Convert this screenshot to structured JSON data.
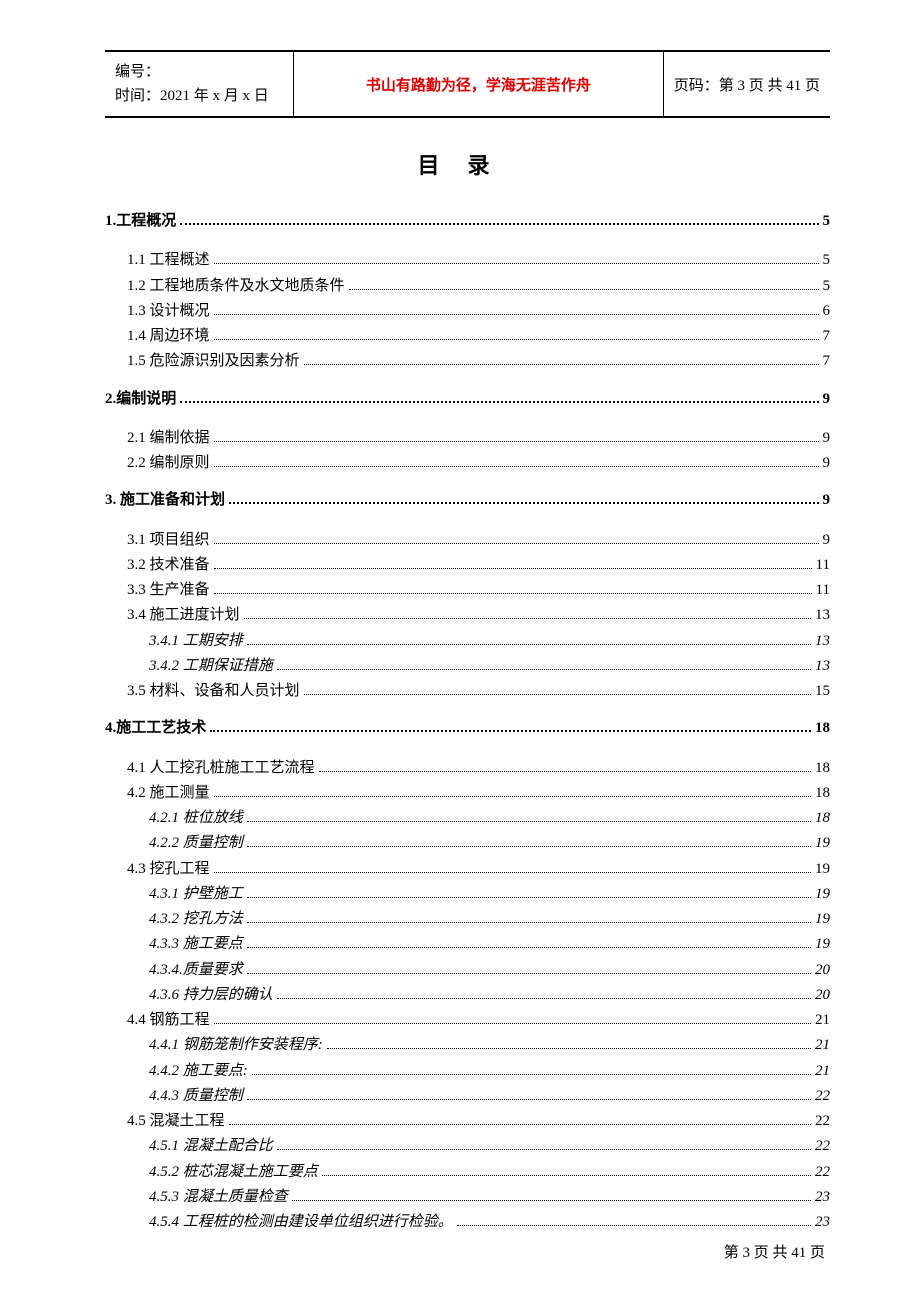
{
  "header": {
    "serial_label": "编号：",
    "time_label": "时间：2021 年 x 月 x 日",
    "center_text": "书山有路勤为径，学海无涯苦作舟",
    "page_code": "页码：第 3 页  共 41 页"
  },
  "toc_title": "目录",
  "toc": [
    {
      "label": "1.工程概况",
      "page": "5",
      "level": 1
    },
    {
      "label": "1.1 工程概述",
      "page": "5",
      "level": 2
    },
    {
      "label": "1.2 工程地质条件及水文地质条件",
      "page": "5",
      "level": 2
    },
    {
      "label": "1.3 设计概况",
      "page": "6",
      "level": 2
    },
    {
      "label": "1.4 周边环境",
      "page": "7",
      "level": 2
    },
    {
      "label": "1.5 危险源识别及因素分析",
      "page": "7",
      "level": 2
    },
    {
      "label": "2.编制说明",
      "page": "9",
      "level": 1
    },
    {
      "label": "2.1 编制依据",
      "page": "9",
      "level": 2
    },
    {
      "label": "2.2 编制原则",
      "page": "9",
      "level": 2
    },
    {
      "label": "3.  施工准备和计划",
      "page": "9",
      "level": 1
    },
    {
      "label": "3.1 项目组织",
      "page": "9",
      "level": 2
    },
    {
      "label": "3.2 技术准备",
      "page": "11",
      "level": 2
    },
    {
      "label": "3.3 生产准备",
      "page": "11",
      "level": 2
    },
    {
      "label": "3.4 施工进度计划",
      "page": "13",
      "level": 2
    },
    {
      "label": "3.4.1 工期安排",
      "page": "13",
      "level": 3
    },
    {
      "label": "3.4.2 工期保证措施",
      "page": "13",
      "level": 3
    },
    {
      "label": "3.5 材料、设备和人员计划",
      "page": "15",
      "level": 2
    },
    {
      "label": "4.施工工艺技术",
      "page": "18",
      "level": 1
    },
    {
      "label": "4.1 人工挖孔桩施工工艺流程",
      "page": "18",
      "level": 2
    },
    {
      "label": "4.2 施工测量",
      "page": "18",
      "level": 2
    },
    {
      "label": "4.2.1 桩位放线",
      "page": "18",
      "level": 3
    },
    {
      "label": "4.2.2 质量控制",
      "page": "19",
      "level": 3
    },
    {
      "label": "4.3 挖孔工程",
      "page": "19",
      "level": 2
    },
    {
      "label": "4.3.1 护壁施工",
      "page": "19",
      "level": 3
    },
    {
      "label": "4.3.2 挖孔方法",
      "page": "19",
      "level": 3
    },
    {
      "label": "4.3.3 施工要点",
      "page": "19",
      "level": 3
    },
    {
      "label": "4.3.4.质量要求",
      "page": "20",
      "level": 3
    },
    {
      "label": "4.3.6 持力层的确认",
      "page": "20",
      "level": 3
    },
    {
      "label": "4.4 钢筋工程",
      "page": "21",
      "level": 2
    },
    {
      "label": "4.4.1 钢筋笼制作安装程序:",
      "page": "21",
      "level": 3
    },
    {
      "label": "4.4.2 施工要点:",
      "page": "21",
      "level": 3
    },
    {
      "label": "4.4.3 质量控制",
      "page": "22",
      "level": 3
    },
    {
      "label": "4.5 混凝土工程",
      "page": "22",
      "level": 2
    },
    {
      "label": "4.5.1 混凝土配合比",
      "page": "22",
      "level": 3
    },
    {
      "label": "4.5.2 桩芯混凝土施工要点",
      "page": "22",
      "level": 3
    },
    {
      "label": "4.5.3 混凝土质量检查",
      "page": "23",
      "level": 3
    },
    {
      "label": "4.5.4 工程桩的检测由建设单位组织进行检验。",
      "page": "23",
      "level": 3
    }
  ],
  "footer": "第 3 页 共 41 页"
}
